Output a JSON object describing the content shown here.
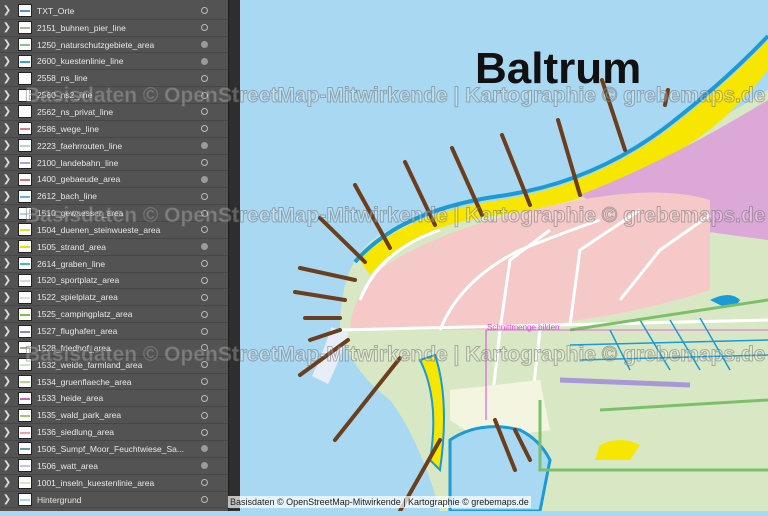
{
  "layers": [
    {
      "name": "TXT_Orte",
      "visible": false,
      "swatch": "#5b8fd6"
    },
    {
      "name": "2151_buhnen_pier_line",
      "visible": false,
      "swatch": "#c0b0a0"
    },
    {
      "name": "1250_naturschutzgebiete_area",
      "visible": true,
      "swatch": "#8cc08c"
    },
    {
      "name": "2600_kuestenlinie_line",
      "visible": true,
      "swatch": "#3aa0d8"
    },
    {
      "name": "2558_ns_line",
      "visible": false,
      "swatch": "#ffffff"
    },
    {
      "name": "2560_ns2_line",
      "visible": false,
      "swatch": "#ffffff"
    },
    {
      "name": "2562_ns_privat_line",
      "visible": false,
      "swatch": "#ffffff"
    },
    {
      "name": "2586_wege_line",
      "visible": false,
      "swatch": "#d08080"
    },
    {
      "name": "2223_faehrrouten_line",
      "visible": true,
      "swatch": "#c0d0e0"
    },
    {
      "name": "2100_landebahn_line",
      "visible": false,
      "swatch": "#b0a0d0"
    },
    {
      "name": "1400_gebaeude_area",
      "visible": true,
      "swatch": "#e07070"
    },
    {
      "name": "2612_bach_line",
      "visible": false,
      "swatch": "#60b8e0"
    },
    {
      "name": "1510_gewaesser_area",
      "visible": false,
      "swatch": "#a8d8f0"
    },
    {
      "name": "1504_duenen_steinwueste_area",
      "visible": false,
      "swatch": "#e8e020"
    },
    {
      "name": "1505_strand_area",
      "visible": true,
      "swatch": "#f0e000"
    },
    {
      "name": "2614_graben_line",
      "visible": false,
      "swatch": "#40b8d0"
    },
    {
      "name": "1520_sportplatz_area",
      "visible": false,
      "swatch": "#d0e0d0"
    },
    {
      "name": "1522_spielplatz_area",
      "visible": false,
      "swatch": "#e0e0e0"
    },
    {
      "name": "1525_campingplatz_area",
      "visible": false,
      "swatch": "#80c040"
    },
    {
      "name": "1527_flughafen_area",
      "visible": false,
      "swatch": "#9080d0"
    },
    {
      "name": "1528_friedhof_area",
      "visible": false,
      "swatch": "#a0a890"
    },
    {
      "name": "1532_weide_farmland_area",
      "visible": false,
      "swatch": "#d0e8c0"
    },
    {
      "name": "1534_gruenflaeche_area",
      "visible": false,
      "swatch": "#b0d890"
    },
    {
      "name": "1533_heide_area",
      "visible": false,
      "swatch": "#d060c0"
    },
    {
      "name": "1535_wald_park_area",
      "visible": false,
      "swatch": "#a0c870"
    },
    {
      "name": "1536_siedlung_area",
      "visible": false,
      "swatch": "#f0a0a0"
    },
    {
      "name": "1506_Sumpf_Moor_Feuchtwiese_Sa...",
      "visible": true,
      "swatch": "#60a0a0"
    },
    {
      "name": "1506_watt_area",
      "visible": true,
      "swatch": "#c0c8e0"
    },
    {
      "name": "1001_inseln_kuestenlinie_area",
      "visible": false,
      "swatch": "#d8e8c0"
    },
    {
      "name": "Hintergrund",
      "visible": false,
      "swatch": "#a9d8f2"
    }
  ],
  "map": {
    "title": "Baltrum",
    "hint": "Schnittmenge bilden",
    "credit": "Basisdaten © OpenStreetMap-Mitwirkende | Kartographie © grebemaps.de",
    "watermark": "Basisdaten © OpenStreetMap-Mitwirkende | Kartographie © grebemaps.de"
  },
  "colors": {
    "water": "#a9d8f2",
    "beach": "#f7e600",
    "settlement": "#f6c9c9",
    "meadow": "#d9e8c4",
    "coast": "#1a9ad6",
    "groyne": "#6b3f1e",
    "heath": "#dca8d8"
  }
}
